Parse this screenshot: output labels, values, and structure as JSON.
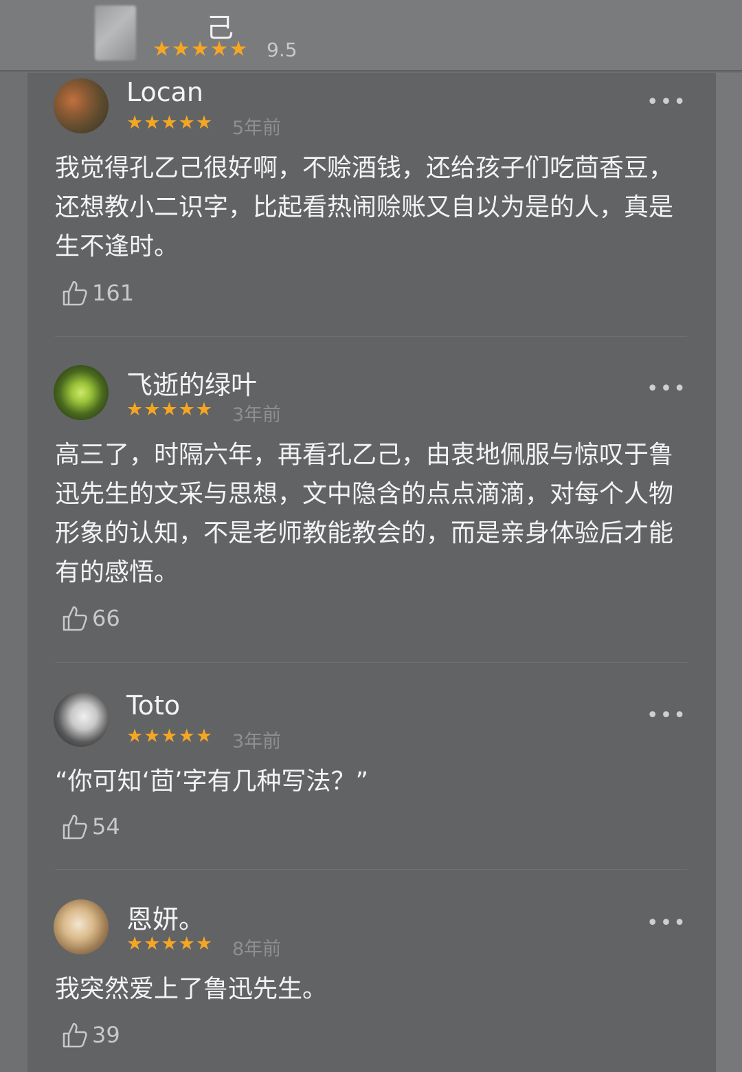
{
  "header": {
    "book_title": "己",
    "stars": "★★★★★",
    "score": "9.5"
  },
  "reviews": [
    {
      "username": "Locan",
      "stars": "★★★★★",
      "time": "5年前",
      "more": "•••",
      "content": "我觉得孔乙己很好啊，不赊酒钱，还给孩子们吃茴香豆，还想教小二识字，比起看热闹赊账又自以为是的人，真是生不逢时。",
      "likes": "161"
    },
    {
      "username": "飞逝的绿叶",
      "stars": "★★★★★",
      "time": "3年前",
      "more": "•••",
      "content": "高三了，时隔六年，再看孔乙己，由衷地佩服与惊叹于鲁迅先生的文采与思想，文中隐含的点点滴滴，对每个人物形象的认知，不是老师教能教会的，而是亲身体验后才能有的感悟。",
      "likes": "66"
    },
    {
      "username": "Toto",
      "stars": "★★★★★",
      "time": "3年前",
      "more": "•••",
      "content": "“你可知‘茴’字有几种写法？”",
      "likes": "54"
    },
    {
      "username": "恩妍。",
      "stars": "★★★★★",
      "time": "8年前",
      "more": "•••",
      "content": "我突然爱上了鲁迅先生。",
      "likes": "39"
    }
  ],
  "colors": {
    "star": "#f5a623",
    "background": "#626365",
    "text": "#f3f3f3"
  }
}
